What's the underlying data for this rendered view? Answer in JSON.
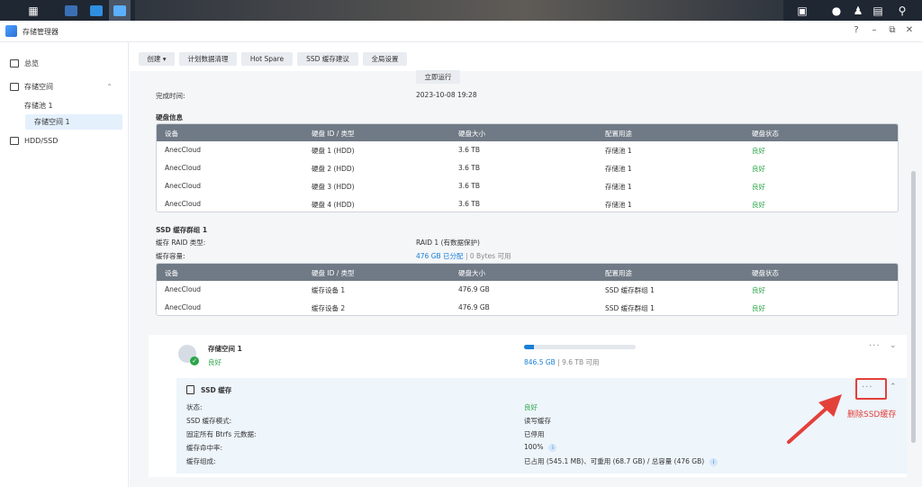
{
  "window": {
    "title": "存储管理器"
  },
  "sidebar": {
    "items": [
      {
        "label": "总览"
      },
      {
        "label": "存储空间"
      },
      {
        "label": "存储池 1"
      },
      {
        "label": "存储空间 1"
      },
      {
        "label": "HDD/SSD"
      }
    ]
  },
  "toolbar": {
    "create": "创建",
    "schedule": "计划数据清理",
    "hotspare": "Hot Spare",
    "ssdadvice": "SSD 缓存建议",
    "global": "全局设置"
  },
  "scrub": {
    "run_now": "立即运行",
    "finish_label": "完成时间:",
    "finish_value": "2023-10-08 19:28"
  },
  "disk_info": {
    "title": "硬盘信息",
    "columns": [
      "设备",
      "硬盘 ID / 类型",
      "硬盘大小",
      "配置用途",
      "硬盘状态"
    ],
    "rows": [
      [
        "AnecCloud",
        "硬盘 1 (HDD)",
        "3.6 TB",
        "存储池 1",
        "良好"
      ],
      [
        "AnecCloud",
        "硬盘 2 (HDD)",
        "3.6 TB",
        "存储池 1",
        "良好"
      ],
      [
        "AnecCloud",
        "硬盘 3 (HDD)",
        "3.6 TB",
        "存储池 1",
        "良好"
      ],
      [
        "AnecCloud",
        "硬盘 4 (HDD)",
        "3.6 TB",
        "存储池 1",
        "良好"
      ]
    ]
  },
  "ssd_group": {
    "title": "SSD 缓存群组 1",
    "raid_label": "缓存 RAID 类型:",
    "raid_value": "RAID 1 (有数据保护)",
    "capacity_label": "缓存容量:",
    "capacity_alloc": "476 GB 已分配",
    "capacity_sep": "|",
    "capacity_free": "0 Bytes 可用",
    "columns": [
      "设备",
      "硬盘 ID / 类型",
      "硬盘大小",
      "配置用途",
      "硬盘状态"
    ],
    "rows": [
      [
        "AnecCloud",
        "缓存设备 1",
        "476.9 GB",
        "SSD 缓存群组 1",
        "良好"
      ],
      [
        "AnecCloud",
        "缓存设备 2",
        "476.9 GB",
        "SSD 缓存群组 1",
        "良好"
      ]
    ]
  },
  "volume": {
    "name": "存储空间 1",
    "status": "良好",
    "used": "846.5 GB",
    "sep": "|",
    "total": "9.6 TB 可用",
    "usage_fraction": 0.088
  },
  "ssd_cache": {
    "title": "SSD 缓存",
    "fields": [
      {
        "label": "状态:",
        "value": "良好"
      },
      {
        "label": "SSD 缓存模式:",
        "value": "读写缓存"
      },
      {
        "label": "固定所有 Btrfs 元数据:",
        "value": "已停用"
      },
      {
        "label": "缓存命中率:",
        "value": "100%"
      },
      {
        "label": "缓存组成:",
        "value": "已占用 (545.1 MB)、可重用 (68.7 GB) / 总容量 (476 GB)"
      }
    ]
  },
  "annotation": {
    "text": "删除SSD缓存",
    "color": "#e3403a"
  },
  "colors": {
    "accent": "#1a7fd6",
    "good": "#2ca54a",
    "header": "#707a86"
  }
}
